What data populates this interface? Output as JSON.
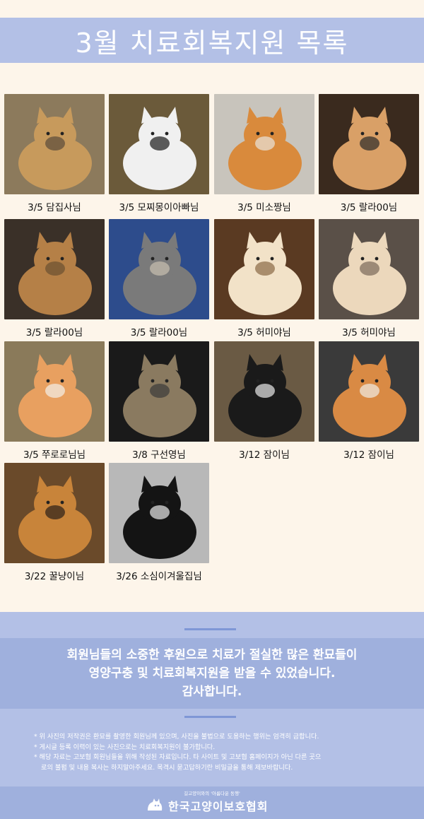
{
  "header": {
    "title": "3월 치료회복지원 목록"
  },
  "cards": [
    {
      "caption": "3/5 담집사님",
      "colors": [
        "#8c7a5c",
        "#c79a5c",
        "#5a4a3a"
      ]
    },
    {
      "caption": "3/5 모찌몽이아빠님",
      "colors": [
        "#6b5a3a",
        "#f0f0f0",
        "#1a1a1a"
      ]
    },
    {
      "caption": "3/5 미소짱님",
      "colors": [
        "#c8c4bc",
        "#d98a3c",
        "#e8e4dc"
      ]
    },
    {
      "caption": "3/5 랄라00님",
      "colors": [
        "#3a2a1e",
        "#d9a067",
        "#2a2a2a"
      ]
    },
    {
      "caption": "3/5 랄라00님",
      "colors": [
        "#3a3028",
        "#b58047",
        "#6a5030"
      ]
    },
    {
      "caption": "3/5 랄라00님",
      "colors": [
        "#2d4c8c",
        "#7a7a7a",
        "#c9c0b0"
      ]
    },
    {
      "caption": "3/5 허미야님",
      "colors": [
        "#5a3a22",
        "#f2e2c8",
        "#8a6a44"
      ]
    },
    {
      "caption": "3/5 허미야님",
      "colors": [
        "#5a5048",
        "#ecd8bc",
        "#7a6a5a"
      ]
    },
    {
      "caption": "3/5 쭈로로님님",
      "colors": [
        "#8a7a5a",
        "#e8a060",
        "#f4f0ea"
      ]
    },
    {
      "caption": "3/8 구선영님",
      "colors": [
        "#1a1a1a",
        "#8a7a60",
        "#3a3a3a"
      ]
    },
    {
      "caption": "3/12 잠이님",
      "colors": [
        "#6a5a44",
        "#1a1a1a",
        "#eaeaea"
      ]
    },
    {
      "caption": "3/12 잠이님",
      "colors": [
        "#3a3a3a",
        "#d98a44",
        "#f0ece6"
      ]
    },
    {
      "caption": "3/22 꿀냥이님",
      "colors": [
        "#6a4a2a",
        "#c8843a",
        "#2a2018"
      ]
    },
    {
      "caption": "3/26 소심이겨울집님",
      "colors": [
        "#b8b8b8",
        "#141414",
        "#e8e8e8"
      ]
    }
  ],
  "thanks": {
    "line1": "회원님들의 소중한 후원으로 치료가 절실한 많은 환묘들이",
    "line2": "영양구충 및 치료회복지원을 받을 수 있었습니다.",
    "line3": "감사합니다."
  },
  "notes": {
    "line1": "* 위 사진의 저작권은 환묘를 촬영한 회원님께 있으며, 사진을 불법으로 도용하는 행위는 엄격히 금합니다.",
    "line2": "* 게시글 등록 이력이 있는 사진으로는 치료회복지원이 불가합니다.",
    "line3": "* 해당 자료는 고보협 회원님들을 위해 작성된 자료입니다. 타 사이트 및 고보협 홈페이지가 아닌 다른 곳으",
    "line4": "로의 불펌 및 내용 복사는 하지말아주세요. 목격시 묻고답하기란 비밀글을 통해 제보바랍니다."
  },
  "footer": {
    "tagline": "길고양이와의 '아름다운 동행'",
    "org": "한국고양이보호협회",
    "logo_icon": "cat-hand-logo-icon"
  },
  "colors": {
    "header_band": "#b3c0e6",
    "background": "#fdf5ea",
    "thanks_band": "#9fb0dd"
  }
}
